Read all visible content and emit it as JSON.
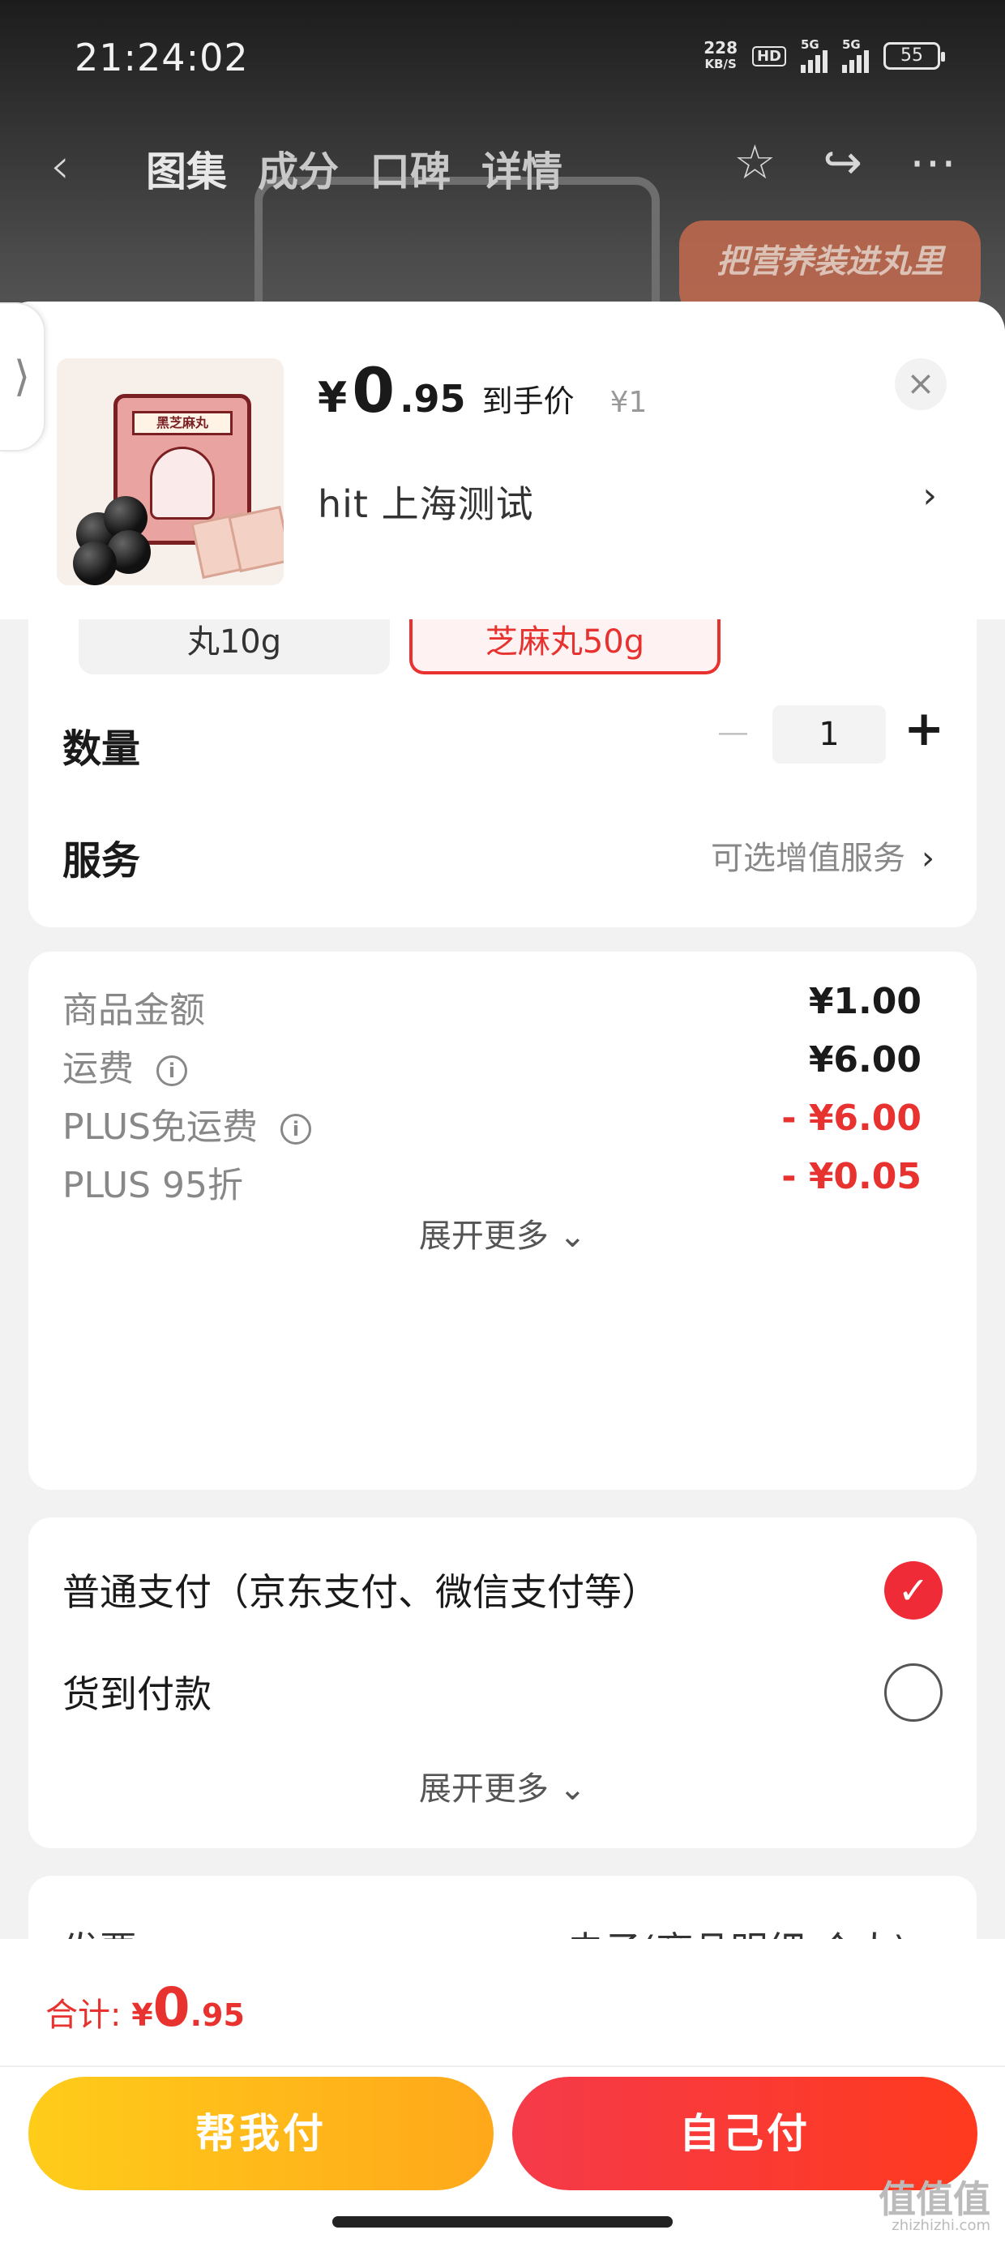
{
  "status_bar": {
    "time": "21:24:02",
    "net_speed": "228",
    "net_unit": "KB/S",
    "hd_label": "HD",
    "signal1_label": "5G",
    "signal2_label": "5G",
    "battery": "55"
  },
  "top_nav": {
    "tabs": [
      {
        "label": "图集"
      },
      {
        "label": "成分"
      },
      {
        "label": "口碑"
      },
      {
        "label": "详情"
      }
    ],
    "promo_text": "把营养装进丸里"
  },
  "product": {
    "currency": "¥",
    "price_int": "0",
    "price_dec": ".95",
    "price_tag": "到手价",
    "orig_price": "¥1",
    "address": "hit  上海测试",
    "package_label": "黑芝麻丸"
  },
  "spec": {
    "options": [
      {
        "label": "丸10g",
        "selected": false
      },
      {
        "label": "芝麻丸50g",
        "selected": true
      }
    ]
  },
  "quantity": {
    "label": "数量",
    "value": "1",
    "minus": "−",
    "plus": "+"
  },
  "service": {
    "label": "服务",
    "value": "可选增值服务"
  },
  "pricing": {
    "rows": [
      {
        "label": "商品金额",
        "value": "¥1.00",
        "info": false,
        "discount": false
      },
      {
        "label": "运费",
        "value": "¥6.00",
        "info": true,
        "discount": false
      },
      {
        "label": "PLUS免运费",
        "value": "- ¥6.00",
        "info": true,
        "discount": true
      },
      {
        "label": "PLUS 95折",
        "value": "- ¥0.05",
        "info": false,
        "discount": true
      }
    ],
    "more_label": "展开更多"
  },
  "payment": {
    "options": [
      {
        "label": "普通支付（京东支付、微信支付等）",
        "selected": true
      },
      {
        "label": "货到付款",
        "selected": false
      }
    ],
    "more_label": "展开更多"
  },
  "invoice": {
    "label": "发票",
    "value": "电子(商品明细-个人)"
  },
  "footer": {
    "total_label": "合计:",
    "currency": "¥",
    "total_int": "0",
    "total_dec": ".95",
    "help_pay_label": "帮我付",
    "self_pay_label": "自己付",
    "watermark": "值值值",
    "watermark_url": "zhizhizhi.com"
  },
  "colors": {
    "accent_red": "#e8322f",
    "button_yellow": "#ffb81a",
    "button_red": "#f5334a"
  }
}
